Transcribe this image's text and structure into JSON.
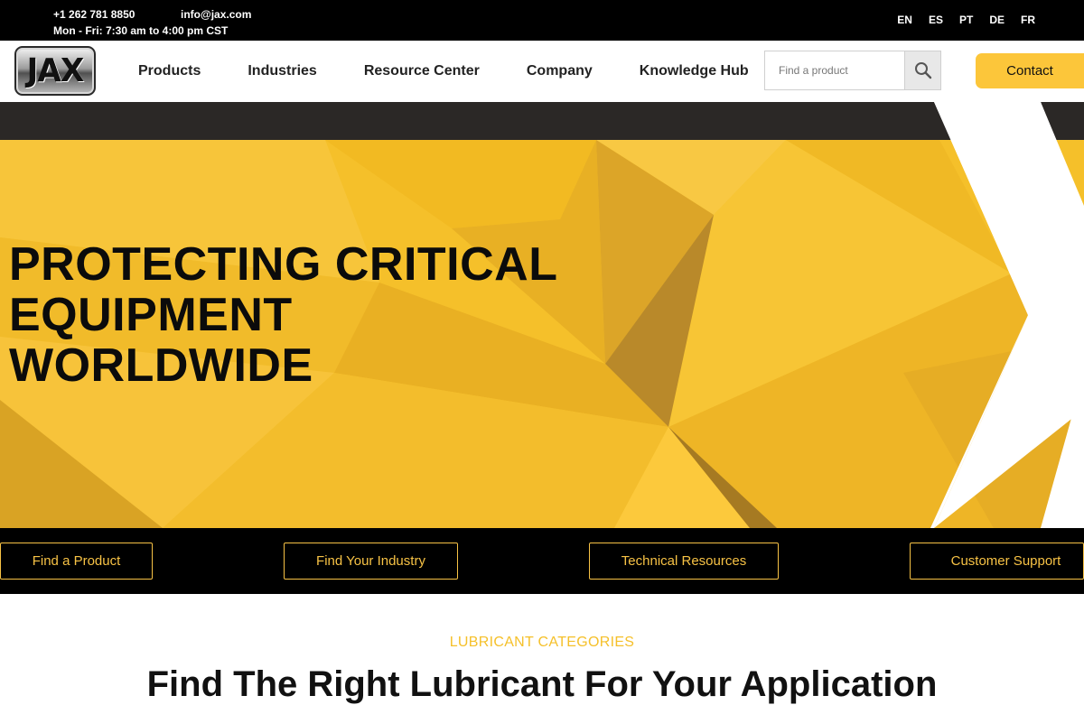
{
  "topbar": {
    "phone": "+1 262 781 8850",
    "email": "info@jax.com",
    "hours": "Mon - Fri: 7:30 am to 4:00 pm CST",
    "languages": [
      "EN",
      "ES",
      "PT",
      "DE",
      "FR"
    ]
  },
  "header": {
    "logo_text": "JAX",
    "nav": [
      "Products",
      "Industries",
      "Resource Center",
      "Company",
      "Knowledge Hub"
    ],
    "search_placeholder": "Find a product",
    "contact_label": "Contact"
  },
  "hero": {
    "title_lines": [
      "PROTECTING CRITICAL",
      "EQUIPMENT",
      "WORLDWIDE"
    ]
  },
  "quick_links": [
    "Find a Product",
    "Find Your Industry",
    "Technical Resources",
    "Customer Support"
  ],
  "categories": {
    "eyebrow": "LUBRICANT CATEGORIES",
    "heading": "Find The Right Lubricant For Your Application"
  },
  "colors": {
    "accent": "#fcc63a",
    "hero_yellow": "#f5c02a",
    "dark": "#000000",
    "outline_gold": "#f7c245"
  },
  "icons": {
    "search_button": "search-icon"
  }
}
